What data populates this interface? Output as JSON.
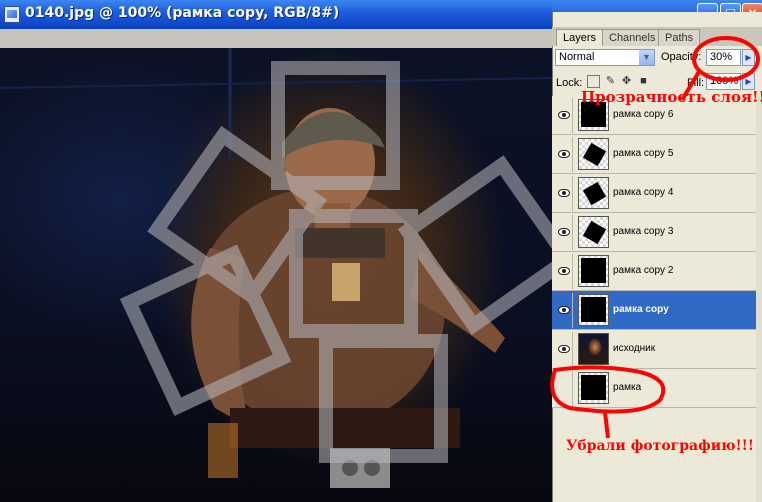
{
  "document": {
    "title": "0140.jpg @ 100% (рамка copy, RGB/8#)"
  },
  "window_controls": {
    "minimize": "_",
    "maximize": "□",
    "close": "×"
  },
  "layers_panel": {
    "tabs": [
      "Layers",
      "Channels",
      "Paths"
    ],
    "active_tab": "Layers",
    "blend_mode": "Normal",
    "opacity_label": "Opacity:",
    "opacity_value": "30%",
    "lock_label": "Lock:",
    "fill_label": "Fill:",
    "fill_value": "100%",
    "layers": [
      {
        "name": "рамка copy 6",
        "visible": true,
        "selected": false,
        "thumb": "square"
      },
      {
        "name": "рамка copy 5",
        "visible": true,
        "selected": false,
        "thumb": "rotated"
      },
      {
        "name": "рамка copy 4",
        "visible": true,
        "selected": false,
        "thumb": "rotated"
      },
      {
        "name": "рамка copy 3",
        "visible": true,
        "selected": false,
        "thumb": "rotated"
      },
      {
        "name": "рамка copy 2",
        "visible": true,
        "selected": false,
        "thumb": "square"
      },
      {
        "name": "рамка copy",
        "visible": true,
        "selected": true,
        "thumb": "square"
      },
      {
        "name": "исходник",
        "visible": true,
        "selected": false,
        "thumb": "photo"
      },
      {
        "name": "рамка",
        "visible": false,
        "selected": false,
        "thumb": "square"
      }
    ]
  },
  "annotations": {
    "opacity_note": "Прозрачность слоя!!!",
    "photo_note": "Убрали фотографию!!!",
    "color": "#ff0000"
  },
  "colors": {
    "selection": "#316ac5",
    "titlebar": "#0a3fc2",
    "panel_bg": "#ece9d8"
  }
}
